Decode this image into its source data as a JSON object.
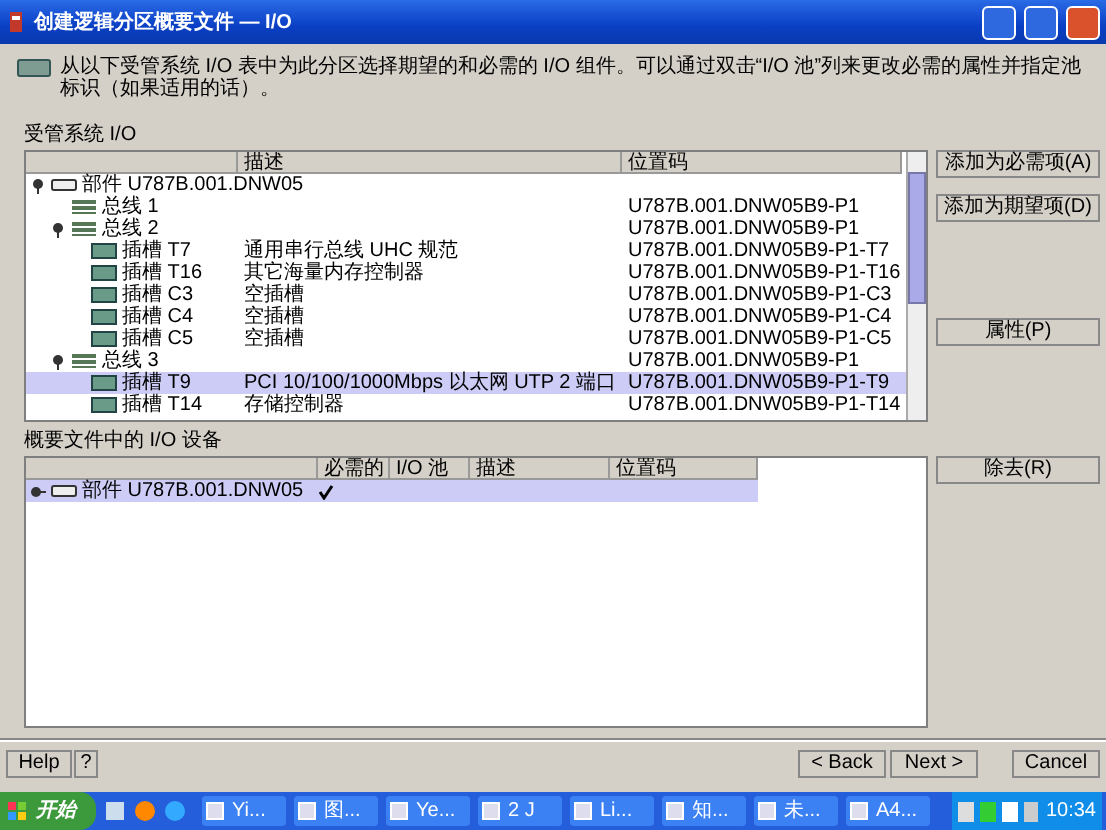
{
  "window": {
    "title": "创建逻辑分区概要文件 — I/O"
  },
  "instructions": "从以下受管系统 I/O 表中为此分区选择期望的和必需的 I/O 组件。可以通过双击“I/O 池”列来更改必需的属性并指定池标识（如果适用的话）。",
  "managed_io": {
    "label": "受管系统 I/O",
    "columns": [
      "描述",
      "位置码"
    ],
    "rows": [
      {
        "kind": "unit",
        "name": "部件 U787B.001.DNW05",
        "expanded": true,
        "selected": false,
        "children": [
          {
            "kind": "bus",
            "name": "总线 1",
            "location": "U787B.001.DNW05B9-P1",
            "selected": false
          },
          {
            "kind": "bus",
            "name": "总线 2",
            "location": "U787B.001.DNW05B9-P1",
            "expanded": true,
            "selected": false,
            "children": [
              {
                "kind": "slot",
                "name": "插槽 T7",
                "description": "通用串行总线 UHC 规范",
                "location": "U787B.001.DNW05B9-P1-T7",
                "selected": false
              },
              {
                "kind": "slot",
                "name": "插槽 T16",
                "description": "其它海量内存控制器",
                "location": "U787B.001.DNW05B9-P1-T16",
                "selected": false
              },
              {
                "kind": "slot",
                "name": "插槽 C3",
                "description": "空插槽",
                "location": "U787B.001.DNW05B9-P1-C3",
                "selected": false
              },
              {
                "kind": "slot",
                "name": "插槽 C4",
                "description": "空插槽",
                "location": "U787B.001.DNW05B9-P1-C4",
                "selected": false
              },
              {
                "kind": "slot",
                "name": "插槽 C5",
                "description": "空插槽",
                "location": "U787B.001.DNW05B9-P1-C5",
                "selected": false
              }
            ]
          },
          {
            "kind": "bus",
            "name": "总线 3",
            "location": "U787B.001.DNW05B9-P1",
            "expanded": true,
            "selected": false,
            "children": [
              {
                "kind": "slot",
                "name": "插槽 T9",
                "description": "PCI 10/100/1000Mbps 以太网 UTP 2 端口",
                "location": "U787B.001.DNW05B9-P1-T9",
                "selected": true
              },
              {
                "kind": "slot",
                "name": "插槽 T14",
                "description": "存储控制器",
                "location": "U787B.001.DNW05B9-P1-T14",
                "selected": false
              }
            ]
          }
        ]
      }
    ],
    "buttons": [
      "添加为必需项(A)",
      "添加为期望项(D)",
      "属性(P)"
    ]
  },
  "profile_io": {
    "label": "概要文件中的 I/O 设备",
    "columns": [
      "必需的",
      "I/O 池",
      "描述",
      "位置码"
    ],
    "rows": [
      {
        "name": "部件 U787B.001.DNW05",
        "required": true,
        "selected": true
      }
    ],
    "buttons": [
      "除去(R)"
    ]
  },
  "footer": {
    "help": "Help",
    "help_key": "?",
    "back": "< Back",
    "next": "Next >",
    "cancel": "Cancel"
  },
  "taskbar": {
    "start": "开始",
    "tasks": [
      "Yi...",
      "图...",
      "Ye...",
      "2 J",
      "Li...",
      "知...",
      "未...",
      "A4..."
    ],
    "clock": "10:34"
  }
}
